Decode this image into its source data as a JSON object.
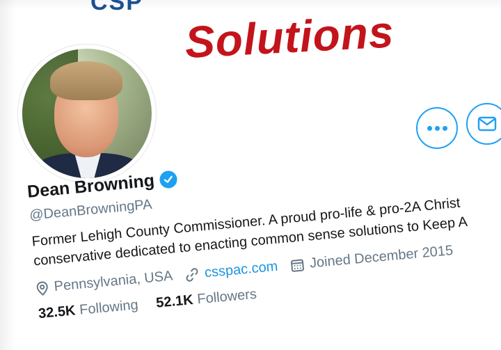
{
  "banner": {
    "logo_text": "CSP",
    "headline": "Solutions"
  },
  "profile": {
    "display_name": "Dean Browning",
    "verified_icon": "verified-badge-icon",
    "handle": "@DeanBrowningPA",
    "bio_line1": "Former Lehigh County Commissioner. A proud pro-life & pro-2A Christ",
    "bio_line2": "conservative dedicated to enacting common sense solutions to Keep A",
    "location": "Pennsylvania, USA",
    "website": "csspac.com",
    "joined": "Joined December 2015",
    "following_count": "32.5K",
    "following_label": "Following",
    "followers_count": "52.1K",
    "followers_label": "Followers"
  },
  "actions": {
    "more_icon": "more-dots-icon",
    "message_icon": "envelope-icon"
  },
  "colors": {
    "accent": "#1da1f2",
    "headline_red": "#c3141b",
    "text_primary": "#14171a",
    "text_secondary": "#657786"
  }
}
